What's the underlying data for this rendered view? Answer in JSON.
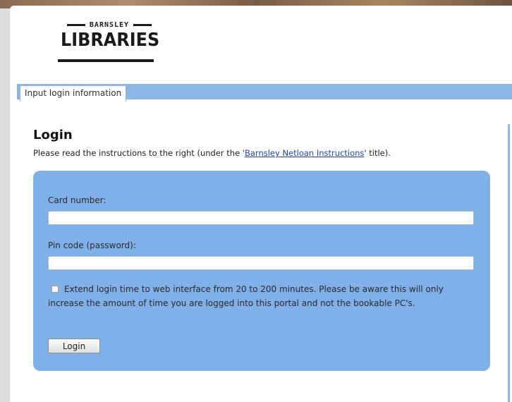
{
  "logo": {
    "small_text": "BARNSLEY",
    "big_text": "LIBRARIES"
  },
  "tab": {
    "label": "Input login information"
  },
  "login": {
    "title": "Login",
    "intro_before": "Please read the instructions to the right (under the '",
    "intro_link": "Barnsley Netloan Instructions",
    "intro_after": "' title).",
    "card_label": "Card number:",
    "card_value": "",
    "pin_label": "Pin code (password):",
    "pin_value": "",
    "extend_checked": false,
    "extend_text": "Extend login time to web interface from 20 to 200 minutes. Please be aware this will only increase the amount of time you are logged into this portal and not the bookable PC's.",
    "button_label": "Login"
  },
  "colors": {
    "accent": "#8cb6e3",
    "panel": "#7fb0e8",
    "link": "#1a3fd0"
  }
}
